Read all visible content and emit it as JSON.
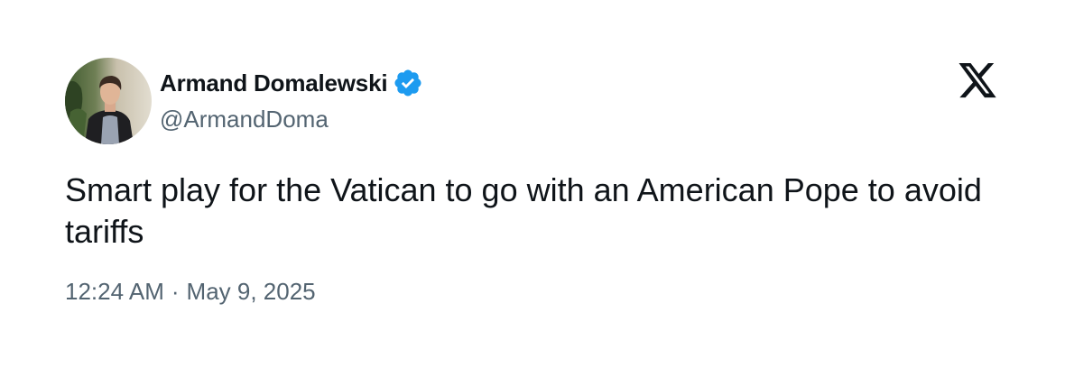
{
  "author": {
    "display_name": "Armand Domalewski",
    "handle": "@ArmandDoma",
    "verified": true,
    "verified_color": "#1d9bf0",
    "avatar_icon": "user-avatar"
  },
  "tweet": {
    "text": "Smart play for the Vatican to go with an American Pope to avoid tariffs",
    "time": "12:24 AM",
    "separator": "·",
    "date": "May 9, 2025"
  },
  "branding": {
    "logo_icon": "x-logo-icon"
  },
  "colors": {
    "text_primary": "#0f1419",
    "text_secondary": "#536471",
    "background": "#ffffff"
  }
}
